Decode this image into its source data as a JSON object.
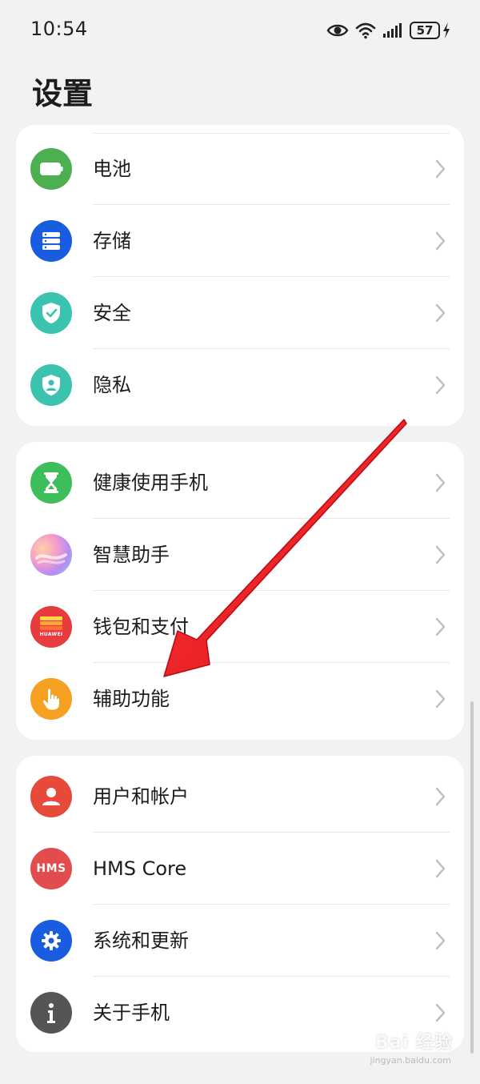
{
  "status_bar": {
    "time": "10:54",
    "battery": "57"
  },
  "page": {
    "title": "设置"
  },
  "groups": [
    {
      "items": [
        {
          "label": "电池",
          "icon": "battery-icon",
          "color": "#4cb050"
        },
        {
          "label": "存储",
          "icon": "storage-icon",
          "color": "#1a5ce0"
        },
        {
          "label": "安全",
          "icon": "security-shield-icon",
          "color": "#3cc3b0"
        },
        {
          "label": "隐私",
          "icon": "privacy-shield-icon",
          "color": "#3cc3b0"
        }
      ]
    },
    {
      "items": [
        {
          "label": "健康使用手机",
          "icon": "hourglass-icon",
          "color": "#3cbe5a"
        },
        {
          "label": "智慧助手",
          "icon": "smart-assistant-icon",
          "color": "#c08ae8"
        },
        {
          "label": "钱包和支付",
          "icon": "huawei-wallet-icon",
          "color": "#e83b3b"
        },
        {
          "label": "辅助功能",
          "icon": "accessibility-hand-icon",
          "color": "#f5a020"
        }
      ]
    },
    {
      "items": [
        {
          "label": "用户和帐户",
          "icon": "user-icon",
          "color": "#e84a3a"
        },
        {
          "label": "HMS Core",
          "icon": "hms-icon",
          "color": "#e24c4c"
        },
        {
          "label": "系统和更新",
          "icon": "system-gear-icon",
          "color": "#1a5ce0"
        },
        {
          "label": "关于手机",
          "icon": "info-icon",
          "color": "#555555"
        }
      ]
    }
  ],
  "icon_texts": {
    "huawei": "HUAWEI",
    "hms": "HMS"
  },
  "watermark": {
    "brand": "Bai 经验",
    "url": "jingyan.baidu.com"
  },
  "annotation_color": "#e8161c"
}
